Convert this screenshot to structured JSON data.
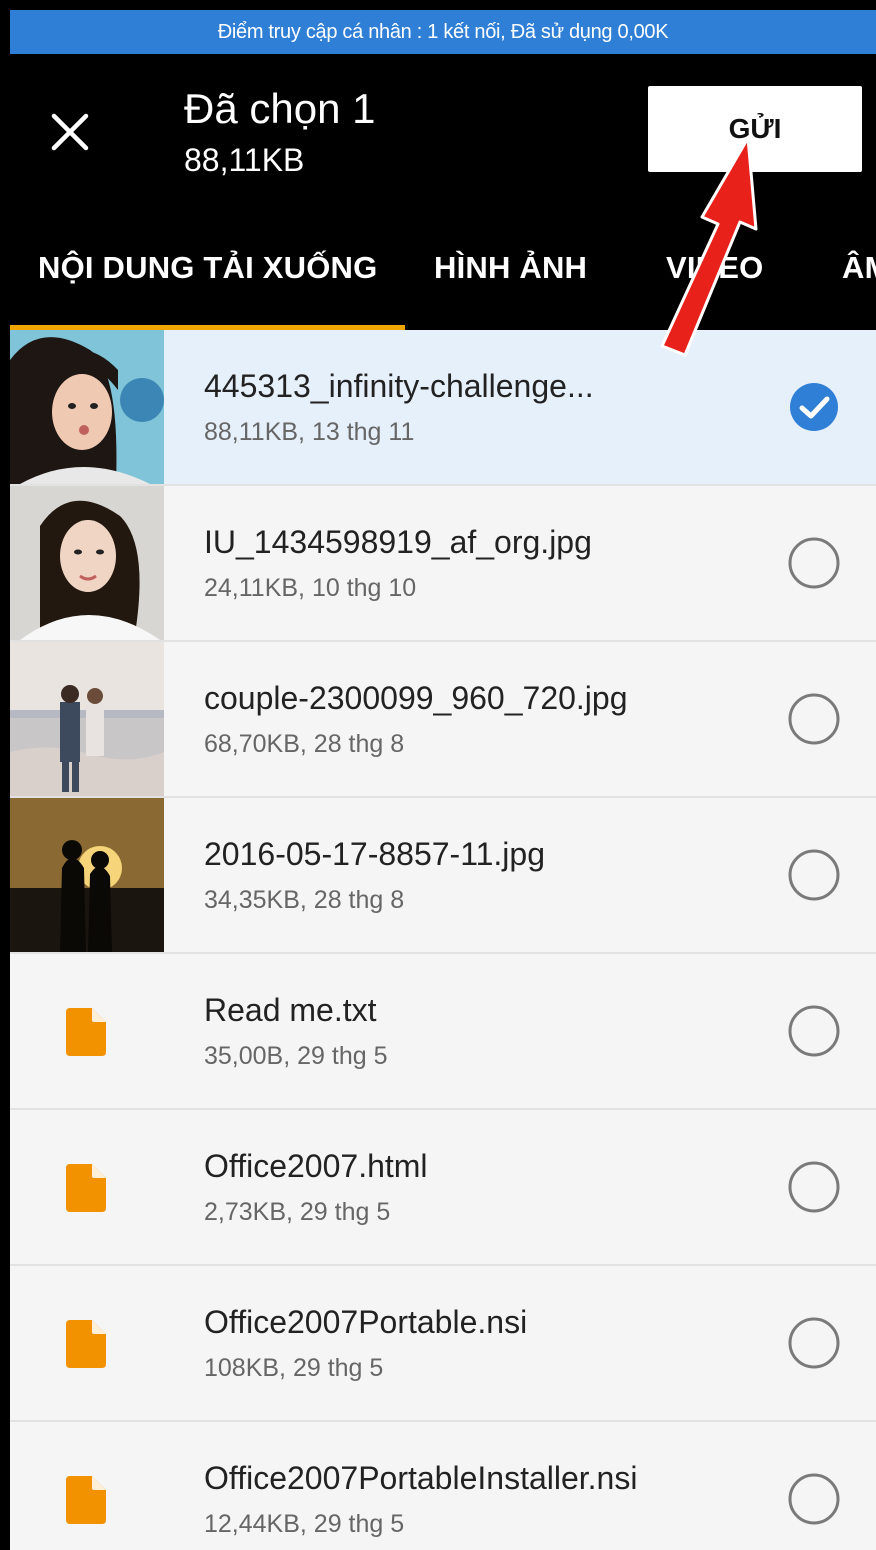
{
  "status_bar": {
    "text": "Điểm truy cập cá nhân : 1 kết nối, Đã sử dụng 0,00K"
  },
  "header": {
    "title": "Đã chọn 1",
    "subtitle": "88,11KB",
    "send_label": "GỬI"
  },
  "tabs": [
    {
      "label": "NỘI DUNG TẢI XUỐNG",
      "active": true
    },
    {
      "label": "HÌNH ẢNH",
      "active": false
    },
    {
      "label": "VIDEO",
      "active": false
    },
    {
      "label": "ÂM",
      "active": false
    }
  ],
  "files": [
    {
      "name": "445313_infinity-challenge...",
      "meta": "88,11KB, 13 thg 11",
      "type": "image",
      "selected": true
    },
    {
      "name": "IU_1434598919_af_org.jpg",
      "meta": "24,11KB, 10 thg 10",
      "type": "image",
      "selected": false
    },
    {
      "name": "couple-2300099_960_720.jpg",
      "meta": "68,70KB, 28 thg 8",
      "type": "image",
      "selected": false
    },
    {
      "name": "2016-05-17-8857-11.jpg",
      "meta": "34,35KB, 28 thg 8",
      "type": "image",
      "selected": false
    },
    {
      "name": "Read me.txt",
      "meta": "35,00B, 29 thg 5",
      "type": "document",
      "selected": false
    },
    {
      "name": "Office2007.html",
      "meta": "2,73KB, 29 thg 5",
      "type": "document",
      "selected": false
    },
    {
      "name": "Office2007Portable.nsi",
      "meta": "108KB, 29 thg 5",
      "type": "document",
      "selected": false
    },
    {
      "name": "Office2007PortableInstaller.nsi",
      "meta": "12,44KB, 29 thg 5",
      "type": "document",
      "selected": false
    }
  ],
  "colors": {
    "status_bar": "#2f7fd6",
    "tab_indicator": "#f0a500",
    "selected_row": "#e6f0fb",
    "check_accent": "#2f7fd6",
    "file_icon": "#f39200",
    "annotation_arrow": "#e8221b"
  },
  "icons": {
    "close": "close-icon",
    "checked": "check-circle-icon",
    "unchecked": "empty-circle-icon",
    "document": "document-icon"
  }
}
